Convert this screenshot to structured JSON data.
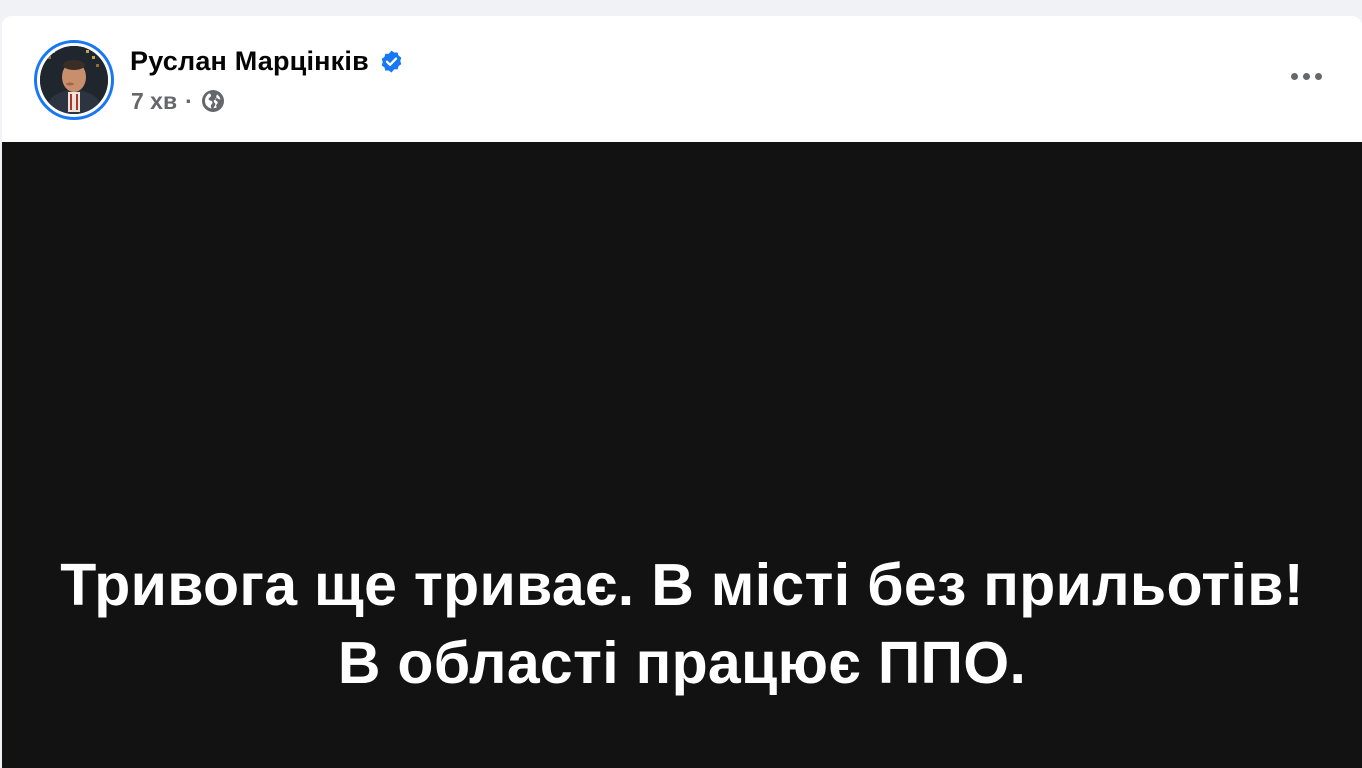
{
  "post": {
    "author": {
      "name": "Руслан Марцінків",
      "verified_icon": "verified-badge-icon",
      "avatar_icon": "profile-photo"
    },
    "meta": {
      "time": "7 хв",
      "separator": "·",
      "audience_icon": "globe-icon"
    },
    "more_icon": "more-options-icon",
    "image_text": {
      "line1": "Тривога ще триває. В місті без прильотів!",
      "line2": "В області працює ППО."
    }
  },
  "colors": {
    "page_background": "#f0f2f5",
    "card_background": "#ffffff",
    "accent": "#1877f2",
    "text_primary": "#050505",
    "text_secondary": "#65676b",
    "image_background": "#121212",
    "image_text": "#ffffff"
  }
}
